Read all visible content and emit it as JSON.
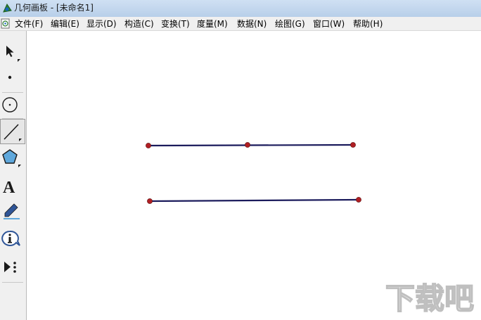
{
  "window": {
    "title": "几何画板 - [未命名1]"
  },
  "menu": {
    "items": [
      "文件(F)",
      "编辑(E)",
      "显示(D)",
      "构造(C)",
      "变换(T)",
      "度量(M)",
      "数据(N)",
      "绘图(G)",
      "窗口(W)",
      "帮助(H)"
    ]
  },
  "toolbox": {
    "tools": [
      {
        "name": "arrow-tool",
        "icon": "arrow-select-icon"
      },
      {
        "name": "point-tool",
        "icon": "point-icon"
      },
      {
        "name": "compass-tool",
        "icon": "circle-icon"
      },
      {
        "name": "straightedge-tool",
        "icon": "segment-icon",
        "selected": true
      },
      {
        "name": "polygon-tool",
        "icon": "pentagon-icon"
      },
      {
        "name": "text-tool",
        "icon": "text-A-icon",
        "glyph": "A"
      },
      {
        "name": "marker-tool",
        "icon": "pen-icon"
      },
      {
        "name": "information-tool",
        "icon": "info-icon"
      },
      {
        "name": "custom-tool",
        "icon": "play-dots-icon"
      }
    ]
  },
  "canvas": {
    "segments": [
      "upper-segment-with-midpoint",
      "lower-segment"
    ],
    "colors": {
      "segment": "#1b1b5c",
      "point": "#b01e23"
    }
  },
  "watermark": {
    "text": "下载吧"
  }
}
